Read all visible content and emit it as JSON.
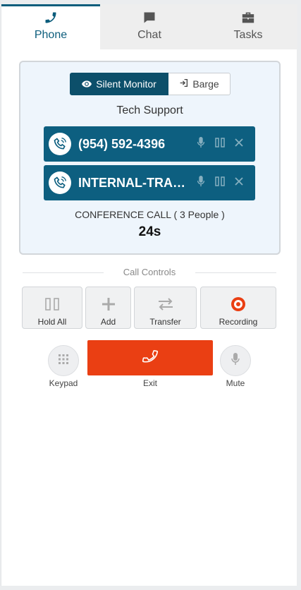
{
  "tabs": [
    {
      "label": "Phone",
      "icon": "phone-icon",
      "active": true
    },
    {
      "label": "Chat",
      "icon": "chat-icon",
      "active": false
    },
    {
      "label": "Tasks",
      "icon": "briefcase-icon",
      "active": false
    }
  ],
  "mode": {
    "silent_monitor": "Silent Monitor",
    "barge": "Barge"
  },
  "conference": {
    "queue": "Tech Support",
    "participants": [
      {
        "name": "(954) 592-4396"
      },
      {
        "name": "INTERNAL-TRANSFER"
      }
    ],
    "count_text": "CONFERENCE CALL ( 3 People )",
    "duration": "24s"
  },
  "controls": {
    "heading": "Call Controls",
    "hold_all": "Hold All",
    "add": "Add",
    "transfer": "Transfer",
    "recording": "Recording",
    "keypad": "Keypad",
    "exit": "Exit",
    "mute": "Mute"
  },
  "colors": {
    "primary": "#0c5d7c",
    "danger": "#ea3f13",
    "panel_bg": "#eef5fc"
  }
}
